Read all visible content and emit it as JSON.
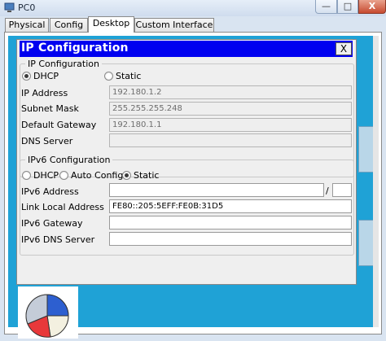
{
  "window": {
    "title": "PC0",
    "icon": "pc-icon",
    "min": "—",
    "max": "□",
    "close": "X"
  },
  "tabs": [
    "Physical",
    "Config",
    "Desktop",
    "Custom Interface"
  ],
  "active_tab": "Desktop",
  "dialog": {
    "title": "IP Configuration",
    "close_label": "X",
    "ipv4": {
      "legend": "IP Configuration",
      "mode_options": [
        "DHCP",
        "Static"
      ],
      "selected_mode": "DHCP",
      "fields": [
        {
          "label": "IP Address",
          "value": "192.180.1.2"
        },
        {
          "label": "Subnet Mask",
          "value": "255.255.255.248"
        },
        {
          "label": "Default Gateway",
          "value": "192.180.1.1"
        },
        {
          "label": "DNS Server",
          "value": ""
        }
      ]
    },
    "ipv6": {
      "legend": "IPv6 Configuration",
      "mode_options": [
        "DHCP",
        "Auto Config",
        "Static"
      ],
      "selected_mode": "Static",
      "fields": [
        {
          "label": "IPv6 Address",
          "value": "",
          "prefix_sep": "/",
          "prefix": ""
        },
        {
          "label": "Link Local Address",
          "value": "FE80::205:5EFF:FE0B:31D5"
        },
        {
          "label": "IPv6 Gateway",
          "value": ""
        },
        {
          "label": "IPv6 DNS Server",
          "value": ""
        }
      ]
    }
  },
  "colors": {
    "header_blue": "#0000f0",
    "desktop_blue": "#1fa2d6"
  }
}
